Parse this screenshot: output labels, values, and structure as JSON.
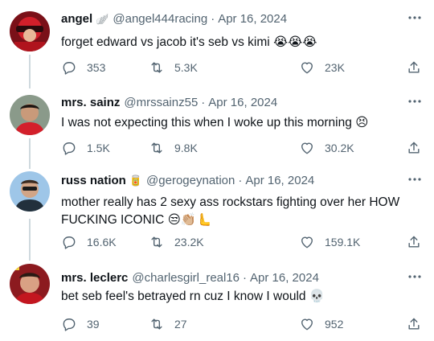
{
  "tweets": [
    {
      "name": "angel",
      "badge": "🪽",
      "handle": "@angel444racing",
      "date": "Apr 16, 2024",
      "text": "forget edward vs jacob it's seb vs kimi 😭😭😭",
      "replies": "353",
      "retweets": "5.3K",
      "likes": "23K"
    },
    {
      "name": "mrs. sainz",
      "badge": "",
      "handle": "@mrssainz55",
      "date": "Apr 16, 2024",
      "text": "I was not expecting this when I woke up this morning 😣",
      "replies": "1.5K",
      "retweets": "9.8K",
      "likes": "30.2K"
    },
    {
      "name": "russ nation",
      "badge": "🥫",
      "handle": "@gerogeynation",
      "date": "Apr 16, 2024",
      "text": "mother really has 2 sexy ass rockstars fighting over her HOW FUCKING ICONIC 😒👏🏼🫷",
      "replies": "16.6K",
      "retweets": "23.2K",
      "likes": "159.1K"
    },
    {
      "name": "mrs. leclerc",
      "badge": "",
      "handle": "@charlesgirl_real16",
      "date": "Apr 16, 2024",
      "text": "bet seb feel's betrayed rn cuz I know I would 💀",
      "replies": "39",
      "retweets": "27",
      "likes": "952"
    }
  ],
  "separator": "·",
  "icons": {
    "reply": "speech-bubble-icon",
    "retweet": "retweet-arrows-icon",
    "like": "heart-outline-icon",
    "share": "share-upload-icon",
    "more": "more-dots-icon"
  },
  "colors": {
    "text": "#0f1419",
    "muted": "#536471",
    "thread_line": "#cfd9de"
  }
}
